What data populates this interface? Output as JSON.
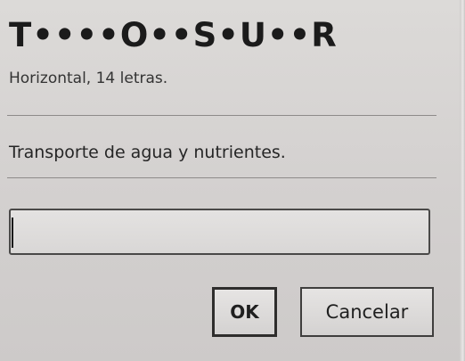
{
  "dialog": {
    "pattern": "T••••O••S•U••R",
    "hint": "Horizontal, 14 letras.",
    "clue": "Transporte de agua y nutrientes.",
    "answer_input": {
      "value": "",
      "placeholder": ""
    },
    "ok_label": "OK",
    "cancel_label": "Cancelar"
  }
}
